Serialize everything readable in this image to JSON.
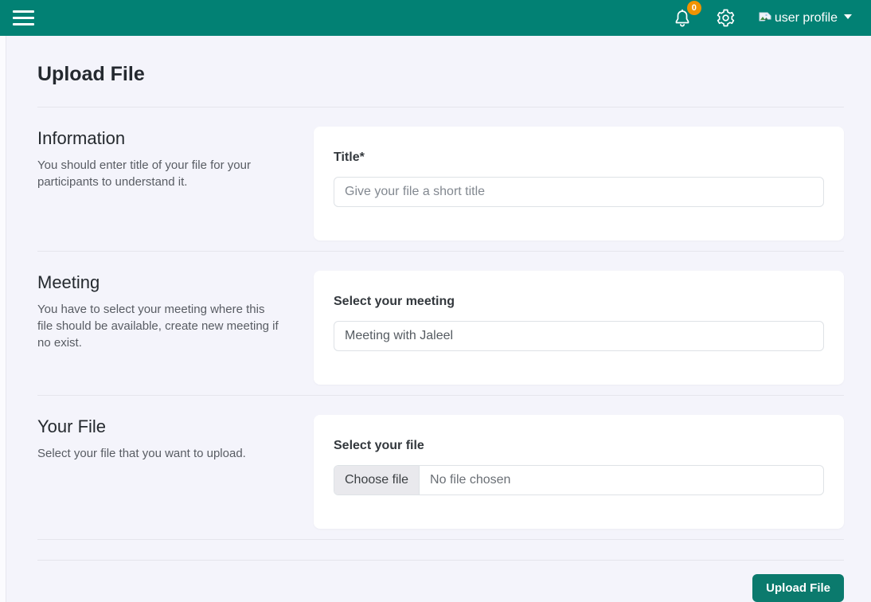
{
  "header": {
    "notification_count": "0",
    "profile_label": "user profile"
  },
  "page": {
    "title": "Upload File"
  },
  "sections": [
    {
      "heading": "Information",
      "description": "You should enter title of your file for your participants to understand it.",
      "field_label": "Title*",
      "placeholder": "Give your file a short title"
    },
    {
      "heading": "Meeting",
      "description": "You have to select your meeting where this file should be available, create new meeting if no exist.",
      "field_label": "Select your meeting",
      "value": "Meeting with Jaleel"
    },
    {
      "heading": "Your File",
      "description": "Select your file that you want to upload.",
      "field_label": "Select your file",
      "file_button": "Choose file",
      "file_status": "No file chosen"
    }
  ],
  "footer": {
    "submit_label": "Upload File"
  },
  "colors": {
    "header_teal": "#028174",
    "button_teal": "#0b7a6d",
    "badge_orange": "#f09300",
    "page_background": "#f4f4fb"
  }
}
